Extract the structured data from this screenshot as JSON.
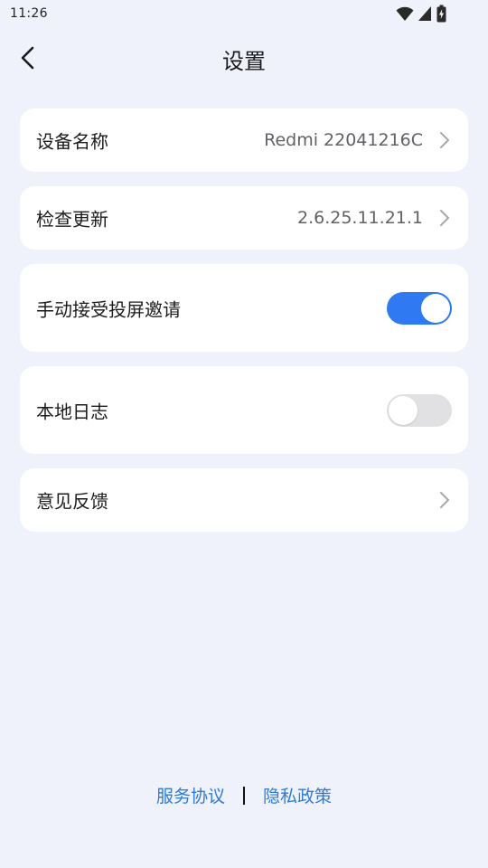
{
  "status_bar": {
    "time": "11:26",
    "icons": [
      "wifi-icon",
      "signal-icon",
      "battery-charging-icon"
    ]
  },
  "header": {
    "title": "设置",
    "back_icon": "chevron-left-icon"
  },
  "settings": {
    "device_name": {
      "label": "设备名称",
      "value": "Redmi 22041216C"
    },
    "check_update": {
      "label": "检查更新",
      "value": "2.6.25.11.21.1"
    },
    "manual_accept": {
      "label": "手动接受投屏邀请",
      "enabled": true
    },
    "local_log": {
      "label": "本地日志",
      "enabled": false
    },
    "feedback": {
      "label": "意见反馈"
    }
  },
  "footer": {
    "service_agreement": "服务协议",
    "privacy_policy": "隐私政策"
  },
  "colors": {
    "background": "#eff2fa",
    "card": "#ffffff",
    "accent": "#2f7af2",
    "link": "#2f7ad6",
    "toggle_off": "#e1e1e4"
  }
}
